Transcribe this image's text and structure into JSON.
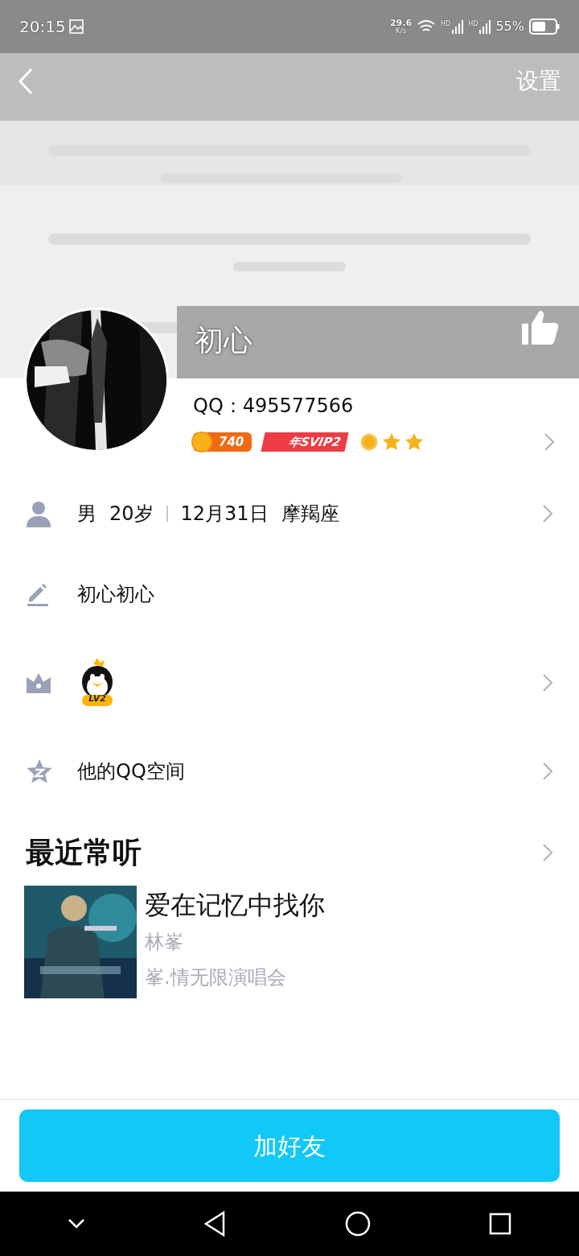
{
  "status_bar": {
    "time": "20:15",
    "speed": "29.6",
    "speed_unit": "K/s",
    "network_labels": [
      "HD",
      "HD"
    ],
    "battery": "55%"
  },
  "header": {
    "settings": "设置"
  },
  "profile": {
    "name": "初心",
    "qq": "QQ：495577566",
    "coins": "740",
    "vip": "年SVIP2"
  },
  "info_rows": [
    {
      "kind": "person",
      "texts": [
        "男",
        "20岁",
        "12月31日",
        "摩羯座"
      ],
      "chevron": true
    },
    {
      "kind": "signature",
      "texts": [
        "初心初心"
      ],
      "chevron": false
    },
    {
      "kind": "level",
      "texts": [
        "LV2"
      ],
      "chevron": true
    },
    {
      "kind": "space",
      "texts": [
        "他的QQ空间"
      ],
      "chevron": true
    }
  ],
  "recent": {
    "title": "最近常听",
    "song": {
      "title": "爱在记忆中找你",
      "artist": "林峯",
      "album": "峯.情无限演唱会"
    }
  },
  "add_friend": "加好友"
}
